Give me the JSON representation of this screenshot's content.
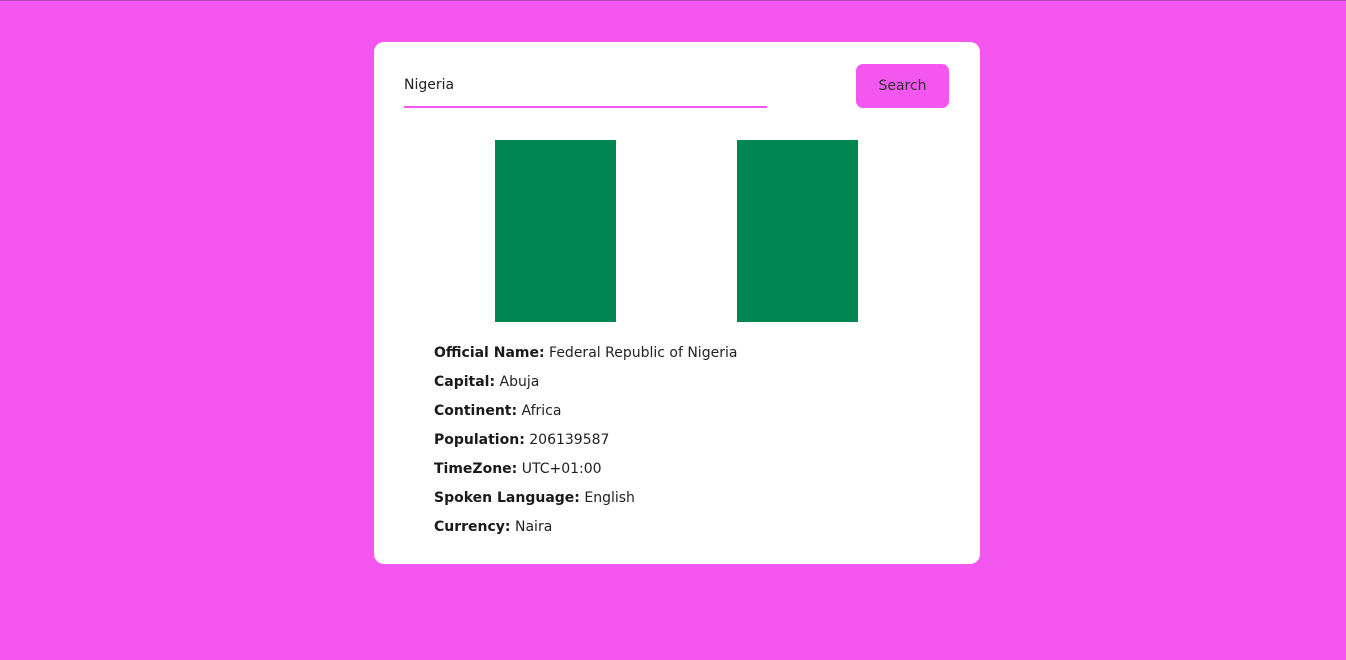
{
  "search": {
    "value": "Nigeria",
    "button_label": "Search"
  },
  "flag": {
    "colors": [
      "#008751",
      "#ffffff",
      "#008751"
    ]
  },
  "details": [
    {
      "label": "Official Name:",
      "value": "Federal Republic of Nigeria"
    },
    {
      "label": "Capital:",
      "value": "Abuja"
    },
    {
      "label": "Continent:",
      "value": "Africa"
    },
    {
      "label": "Population:",
      "value": "206139587"
    },
    {
      "label": "TimeZone:",
      "value": "UTC+01:00"
    },
    {
      "label": "Spoken Language:",
      "value": "English"
    },
    {
      "label": "Currency:",
      "value": "Naira"
    }
  ]
}
